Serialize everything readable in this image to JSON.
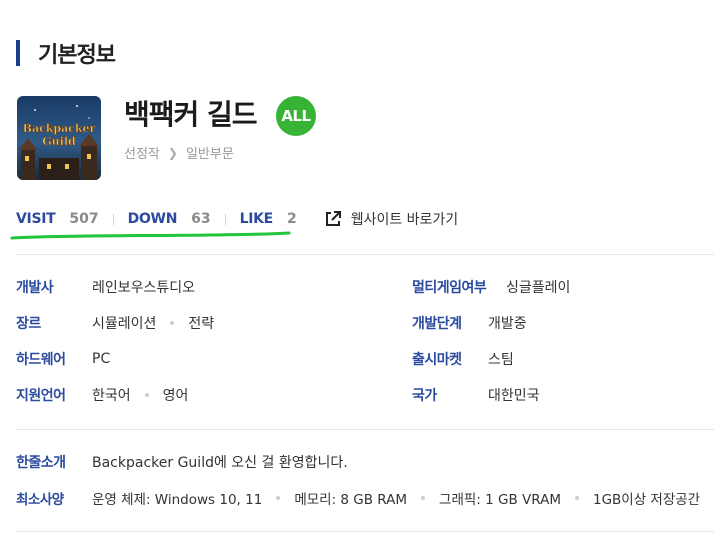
{
  "section": {
    "title": "기본정보"
  },
  "game": {
    "title": "백팩커 길드",
    "rating": "ALL",
    "thumbnail_text_1": "Backpacker",
    "thumbnail_text_2": "Guild"
  },
  "breadcrumb": {
    "items": [
      "선정작",
      "일반부문"
    ]
  },
  "stats": {
    "visit_label": "VISIT",
    "visit_value": "507",
    "down_label": "DOWN",
    "down_value": "63",
    "like_label": "LIKE",
    "like_value": "2",
    "website_label": "웹사이트 바로가기"
  },
  "info": {
    "developer": {
      "label": "개발사",
      "value": "레인보우스튜디오"
    },
    "multiplayer": {
      "label": "멀티게임여부",
      "value": "싱글플레이"
    },
    "genre": {
      "label": "장르",
      "values": [
        "시뮬레이션",
        "전략"
      ]
    },
    "stage": {
      "label": "개발단계",
      "value": "개발중"
    },
    "hardware": {
      "label": "하드웨어",
      "value": "PC"
    },
    "market": {
      "label": "출시마켓",
      "value": "스팀"
    },
    "language": {
      "label": "지원언어",
      "values": [
        "한국어",
        "영어"
      ]
    },
    "country": {
      "label": "국가",
      "value": "대한민국"
    },
    "intro": {
      "label": "한줄소개",
      "value": "Backpacker Guild에 오신 걸 환영합니다."
    },
    "requirements": {
      "label": "최소사양",
      "values": [
        "운영 체제: Windows 10, 11",
        "메모리: 8 GB RAM",
        "그래픽: 1 GB VRAM",
        "1GB이상 저장공간"
      ]
    }
  },
  "colors": {
    "accent": "#2b4ba0",
    "rating_badge": "#37b336",
    "highlight_underline": "#22c43a"
  }
}
